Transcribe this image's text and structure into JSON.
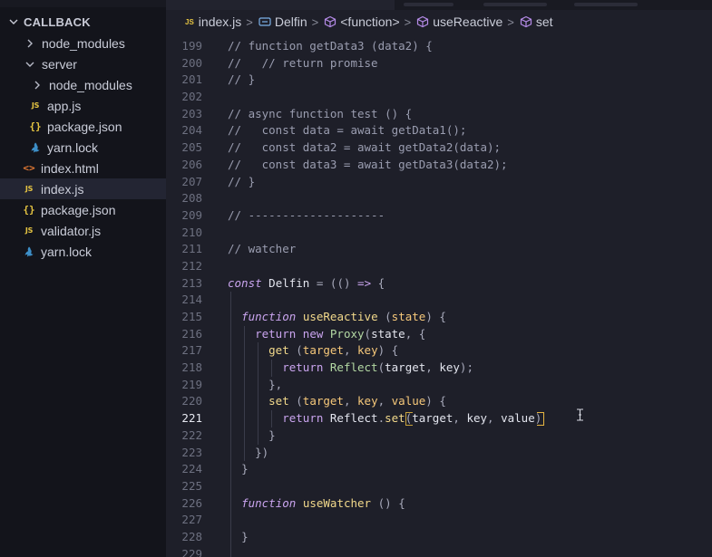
{
  "sidebar": {
    "section_title": "CALLBACK",
    "items": [
      {
        "label": "node_modules",
        "kind": "folder",
        "expanded": false,
        "depth": 1
      },
      {
        "label": "server",
        "kind": "folder",
        "expanded": true,
        "depth": 1
      },
      {
        "label": "node_modules",
        "kind": "folder",
        "expanded": false,
        "depth": 2
      },
      {
        "label": "app.js",
        "kind": "js",
        "depth": 2
      },
      {
        "label": "package.json",
        "kind": "json",
        "depth": 2
      },
      {
        "label": "yarn.lock",
        "kind": "yarn",
        "depth": 2
      },
      {
        "label": "index.html",
        "kind": "html",
        "depth": 1
      },
      {
        "label": "index.js",
        "kind": "js",
        "depth": 1,
        "active": true
      },
      {
        "label": "package.json",
        "kind": "json",
        "depth": 1
      },
      {
        "label": "validator.js",
        "kind": "js",
        "depth": 1
      },
      {
        "label": "yarn.lock",
        "kind": "yarn",
        "depth": 1
      }
    ],
    "icons": {
      "js": "JS",
      "json": "{}",
      "html": "<>",
      "folder": "chevron-right-icon",
      "yarn": "yarn-icon"
    }
  },
  "breadcrumb": {
    "js_badge": "JS",
    "file": "index.js",
    "symbol": "Delfin",
    "function": "<function>",
    "method1": "useReactive",
    "method2": "set",
    "separator": ">"
  },
  "editor": {
    "current_line": 221,
    "lines": [
      {
        "n": 199,
        "tokens": [
          [
            "c",
            "// function getData3 (data2) {"
          ]
        ]
      },
      {
        "n": 200,
        "tokens": [
          [
            "c",
            "//   // return promise"
          ]
        ]
      },
      {
        "n": 201,
        "tokens": [
          [
            "c",
            "// }"
          ]
        ]
      },
      {
        "n": 202,
        "tokens": []
      },
      {
        "n": 203,
        "tokens": [
          [
            "c",
            "// async function test () {"
          ]
        ]
      },
      {
        "n": 204,
        "tokens": [
          [
            "c",
            "//   const data = await getData1();"
          ]
        ]
      },
      {
        "n": 205,
        "tokens": [
          [
            "c",
            "//   const data2 = await getData2(data);"
          ]
        ]
      },
      {
        "n": 206,
        "tokens": [
          [
            "c",
            "//   const data3 = await getData3(data2);"
          ]
        ]
      },
      {
        "n": 207,
        "tokens": [
          [
            "c",
            "// }"
          ]
        ]
      },
      {
        "n": 208,
        "tokens": []
      },
      {
        "n": 209,
        "tokens": [
          [
            "c",
            "// --------------------"
          ]
        ]
      },
      {
        "n": 210,
        "tokens": []
      },
      {
        "n": 211,
        "tokens": [
          [
            "c",
            "// watcher"
          ]
        ]
      },
      {
        "n": 212,
        "tokens": []
      },
      {
        "n": 213,
        "tokens": [
          [
            "ki",
            "const"
          ],
          [
            "t",
            " "
          ],
          [
            "p",
            "Delfin"
          ],
          [
            "t",
            " "
          ],
          [
            "u",
            "="
          ],
          [
            "t",
            " "
          ],
          [
            "u",
            "(("
          ],
          [
            "u",
            ")"
          ],
          [
            "t",
            " "
          ],
          [
            "a",
            "=>"
          ],
          [
            "t",
            " "
          ],
          [
            "u",
            "{"
          ]
        ]
      },
      {
        "n": 214,
        "tokens": []
      },
      {
        "n": 215,
        "tokens": [
          [
            "t",
            "  "
          ],
          [
            "ki",
            "function"
          ],
          [
            "t",
            " "
          ],
          [
            "f",
            "useReactive"
          ],
          [
            "t",
            " "
          ],
          [
            "u",
            "("
          ],
          [
            "v",
            "state"
          ],
          [
            "u",
            ")"
          ],
          [
            "t",
            " "
          ],
          [
            "u",
            "{"
          ]
        ]
      },
      {
        "n": 216,
        "tokens": [
          [
            "t",
            "    "
          ],
          [
            "k",
            "return"
          ],
          [
            "t",
            " "
          ],
          [
            "k",
            "new"
          ],
          [
            "t",
            " "
          ],
          [
            "y",
            "Proxy"
          ],
          [
            "u",
            "("
          ],
          [
            "p",
            "state"
          ],
          [
            "u",
            ","
          ],
          [
            "t",
            " "
          ],
          [
            "u",
            "{"
          ]
        ]
      },
      {
        "n": 217,
        "tokens": [
          [
            "t",
            "      "
          ],
          [
            "f",
            "get"
          ],
          [
            "t",
            " "
          ],
          [
            "u",
            "("
          ],
          [
            "v",
            "target"
          ],
          [
            "u",
            ","
          ],
          [
            "t",
            " "
          ],
          [
            "v",
            "key"
          ],
          [
            "u",
            ")"
          ],
          [
            "t",
            " "
          ],
          [
            "u",
            "{"
          ]
        ]
      },
      {
        "n": 218,
        "tokens": [
          [
            "t",
            "        "
          ],
          [
            "k",
            "return"
          ],
          [
            "t",
            " "
          ],
          [
            "y",
            "Reflect"
          ],
          [
            "u",
            "("
          ],
          [
            "p",
            "target"
          ],
          [
            "u",
            ","
          ],
          [
            "t",
            " "
          ],
          [
            "p",
            "key"
          ],
          [
            "u",
            ");"
          ]
        ]
      },
      {
        "n": 219,
        "tokens": [
          [
            "t",
            "      "
          ],
          [
            "u",
            "},"
          ]
        ]
      },
      {
        "n": 220,
        "tokens": [
          [
            "t",
            "      "
          ],
          [
            "f",
            "set"
          ],
          [
            "t",
            " "
          ],
          [
            "u",
            "("
          ],
          [
            "v",
            "target"
          ],
          [
            "u",
            ","
          ],
          [
            "t",
            " "
          ],
          [
            "v",
            "key"
          ],
          [
            "u",
            ","
          ],
          [
            "t",
            " "
          ],
          [
            "v",
            "value"
          ],
          [
            "u",
            ")"
          ],
          [
            "t",
            " "
          ],
          [
            "u",
            "{"
          ]
        ]
      },
      {
        "n": 221,
        "tokens": [
          [
            "t",
            "        "
          ],
          [
            "k",
            "return"
          ],
          [
            "t",
            " "
          ],
          [
            "p",
            "Reflect"
          ],
          [
            "u",
            "."
          ],
          [
            "f",
            "set"
          ],
          [
            "u",
            "("
          ],
          [
            "p",
            "target"
          ],
          [
            "u",
            ","
          ],
          [
            "t",
            " "
          ],
          [
            "p",
            "key"
          ],
          [
            "u",
            ","
          ],
          [
            "t",
            " "
          ],
          [
            "p",
            "value"
          ],
          [
            "u",
            ")"
          ]
        ]
      },
      {
        "n": 222,
        "tokens": [
          [
            "t",
            "      "
          ],
          [
            "u",
            "}"
          ]
        ]
      },
      {
        "n": 223,
        "tokens": [
          [
            "t",
            "    "
          ],
          [
            "u",
            "})"
          ]
        ]
      },
      {
        "n": 224,
        "tokens": [
          [
            "t",
            "  "
          ],
          [
            "u",
            "}"
          ]
        ]
      },
      {
        "n": 225,
        "tokens": []
      },
      {
        "n": 226,
        "tokens": [
          [
            "t",
            "  "
          ],
          [
            "ki",
            "function"
          ],
          [
            "t",
            " "
          ],
          [
            "f",
            "useWatcher"
          ],
          [
            "t",
            " "
          ],
          [
            "u",
            "()"
          ],
          [
            "t",
            " "
          ],
          [
            "u",
            "{"
          ]
        ]
      },
      {
        "n": 227,
        "tokens": []
      },
      {
        "n": 228,
        "tokens": [
          [
            "t",
            "  "
          ],
          [
            "u",
            "}"
          ]
        ]
      },
      {
        "n": 229,
        "tokens": []
      }
    ]
  },
  "colors": {
    "comment": "#9a9db0",
    "keyword": "#c9a4ee",
    "function": "#f2d98b",
    "param": "#f6c87a",
    "type": "#b3d8a3",
    "bracket_match": "#e5b441"
  }
}
